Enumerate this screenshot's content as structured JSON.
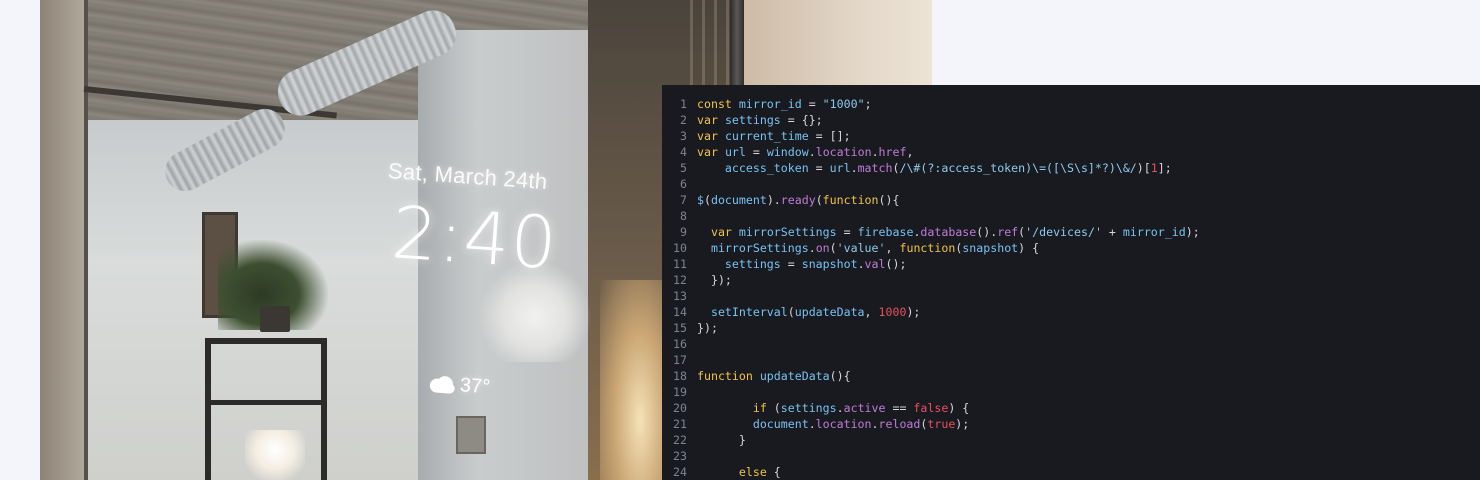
{
  "mirror": {
    "date": "Sat, March 24th",
    "time": "2:40",
    "temperature": "37°",
    "weather_icon": "cloud-icon"
  },
  "colors": {
    "editor_background": "#181a1f",
    "line_number": "#7f848e",
    "keyword": "#f2c347",
    "variable": "#79c1f3",
    "punctuation": "#d4d6da",
    "string": "#8ec9ef",
    "function_call": "#c07bd9",
    "number_literal": "#e7505c",
    "page_background": "#f3f5fb"
  },
  "editor": {
    "lines": [
      {
        "num": "1",
        "tokens": [
          [
            "k",
            "const"
          ],
          [
            "p",
            " "
          ],
          [
            "v",
            "mirror_id"
          ],
          [
            "p",
            " = "
          ],
          [
            "s",
            "\"1000\""
          ],
          [
            "p",
            ";"
          ]
        ]
      },
      {
        "num": "2",
        "tokens": [
          [
            "k",
            "var"
          ],
          [
            "p",
            " "
          ],
          [
            "v",
            "settings"
          ],
          [
            "p",
            " = {};"
          ]
        ]
      },
      {
        "num": "3",
        "tokens": [
          [
            "k",
            "var"
          ],
          [
            "p",
            " "
          ],
          [
            "v",
            "current_time"
          ],
          [
            "p",
            " = [];"
          ]
        ]
      },
      {
        "num": "4",
        "tokens": [
          [
            "k",
            "var"
          ],
          [
            "p",
            " "
          ],
          [
            "v",
            "url"
          ],
          [
            "p",
            " = "
          ],
          [
            "v",
            "window"
          ],
          [
            "p",
            "."
          ],
          [
            "f",
            "location"
          ],
          [
            "p",
            "."
          ],
          [
            "f",
            "href"
          ],
          [
            "p",
            ","
          ]
        ]
      },
      {
        "num": "5",
        "tokens": [
          [
            "p",
            "    "
          ],
          [
            "v",
            "access_token"
          ],
          [
            "p",
            " = "
          ],
          [
            "v",
            "url"
          ],
          [
            "p",
            "."
          ],
          [
            "f",
            "match"
          ],
          [
            "p",
            "("
          ],
          [
            "s",
            "/\\#(?:access_token)\\=([\\S\\s]*?)\\&/"
          ],
          [
            "p",
            ")["
          ],
          [
            "n",
            "1"
          ],
          [
            "p",
            "];"
          ]
        ]
      },
      {
        "num": "6",
        "tokens": []
      },
      {
        "num": "7",
        "tokens": [
          [
            "v",
            "$"
          ],
          [
            "p",
            "("
          ],
          [
            "v",
            "document"
          ],
          [
            "p",
            ")."
          ],
          [
            "f",
            "ready"
          ],
          [
            "p",
            "("
          ],
          [
            "k",
            "function"
          ],
          [
            "p",
            "(){"
          ]
        ]
      },
      {
        "num": "8",
        "tokens": []
      },
      {
        "num": "9",
        "tokens": [
          [
            "p",
            "  "
          ],
          [
            "k",
            "var"
          ],
          [
            "p",
            " "
          ],
          [
            "v",
            "mirrorSettings"
          ],
          [
            "p",
            " = "
          ],
          [
            "v",
            "firebase"
          ],
          [
            "p",
            "."
          ],
          [
            "f",
            "database"
          ],
          [
            "p",
            "()."
          ],
          [
            "f",
            "ref"
          ],
          [
            "p",
            "("
          ],
          [
            "s",
            "'/devices/'"
          ],
          [
            "p",
            " + "
          ],
          [
            "v",
            "mirror_id"
          ],
          [
            "p",
            ");"
          ]
        ]
      },
      {
        "num": "10",
        "tokens": [
          [
            "p",
            "  "
          ],
          [
            "v",
            "mirrorSettings"
          ],
          [
            "p",
            "."
          ],
          [
            "f",
            "on"
          ],
          [
            "p",
            "("
          ],
          [
            "s",
            "'value'"
          ],
          [
            "p",
            ", "
          ],
          [
            "k",
            "function"
          ],
          [
            "p",
            "("
          ],
          [
            "v",
            "snapshot"
          ],
          [
            "p",
            ") {"
          ]
        ]
      },
      {
        "num": "11",
        "tokens": [
          [
            "p",
            "    "
          ],
          [
            "v",
            "settings"
          ],
          [
            "p",
            " = "
          ],
          [
            "v",
            "snapshot"
          ],
          [
            "p",
            "."
          ],
          [
            "f",
            "val"
          ],
          [
            "p",
            "();"
          ]
        ]
      },
      {
        "num": "12",
        "tokens": [
          [
            "p",
            "  });"
          ]
        ]
      },
      {
        "num": "13",
        "tokens": []
      },
      {
        "num": "14",
        "tokens": [
          [
            "p",
            "  "
          ],
          [
            "v",
            "setInterval"
          ],
          [
            "p",
            "("
          ],
          [
            "v",
            "updateData"
          ],
          [
            "p",
            ", "
          ],
          [
            "n",
            "1000"
          ],
          [
            "p",
            ");"
          ]
        ]
      },
      {
        "num": "15",
        "tokens": [
          [
            "p",
            "});"
          ]
        ]
      },
      {
        "num": "16",
        "tokens": []
      },
      {
        "num": "17",
        "tokens": []
      },
      {
        "num": "18",
        "tokens": [
          [
            "k",
            "function"
          ],
          [
            "p",
            " "
          ],
          [
            "v",
            "updateData"
          ],
          [
            "p",
            "(){"
          ]
        ]
      },
      {
        "num": "19",
        "tokens": []
      },
      {
        "num": "20",
        "tokens": [
          [
            "p",
            "        "
          ],
          [
            "k",
            "if"
          ],
          [
            "p",
            " ("
          ],
          [
            "v",
            "settings"
          ],
          [
            "p",
            "."
          ],
          [
            "f",
            "active"
          ],
          [
            "p",
            " == "
          ],
          [
            "n",
            "false"
          ],
          [
            "p",
            ") {"
          ]
        ]
      },
      {
        "num": "21",
        "tokens": [
          [
            "p",
            "        "
          ],
          [
            "v",
            "document"
          ],
          [
            "p",
            "."
          ],
          [
            "f",
            "location"
          ],
          [
            "p",
            "."
          ],
          [
            "f",
            "reload"
          ],
          [
            "p",
            "("
          ],
          [
            "n",
            "true"
          ],
          [
            "p",
            ");"
          ]
        ]
      },
      {
        "num": "22",
        "tokens": [
          [
            "p",
            "      }"
          ]
        ]
      },
      {
        "num": "23",
        "tokens": []
      },
      {
        "num": "24",
        "tokens": [
          [
            "p",
            "      "
          ],
          [
            "k",
            "else"
          ],
          [
            "p",
            " {"
          ]
        ]
      }
    ]
  }
}
